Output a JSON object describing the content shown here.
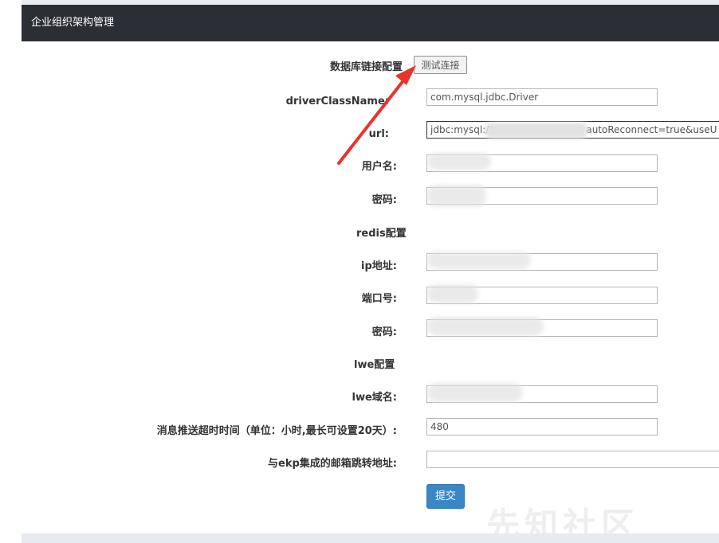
{
  "header": {
    "title": "企业组织架构管理"
  },
  "database": {
    "section_label": "数据库链接配置",
    "test_button_label": "测试连接",
    "driver_label": "driverClassName:",
    "driver_value": "com.mysql.jdbc.Driver",
    "url_label": "url:",
    "url_value_prefix": "jdbc:mysql://",
    "url_value_suffix": "autoReconnect=true&useU",
    "username_label": "用户名:",
    "password_label": "密码:"
  },
  "redis": {
    "section_label": "redis配置",
    "ip_label": "ip地址:",
    "port_label": "端口号:",
    "password_label": "密码:"
  },
  "lwe": {
    "section_label": "lwe配置",
    "domain_label": "lwe域名:"
  },
  "push": {
    "timeout_label": "消息推送超时时间（单位：小时,最长可设置20天）:",
    "timeout_value": "480",
    "mailbox_label": "与ekp集成的邮箱跳转地址:",
    "mailbox_value": ""
  },
  "actions": {
    "submit_label": "提交"
  },
  "watermark": {
    "text": "先知社区"
  },
  "colors": {
    "header_bg": "#2b2e35",
    "submit_bg": "#3a87c8",
    "arrow": "#e8342a"
  }
}
